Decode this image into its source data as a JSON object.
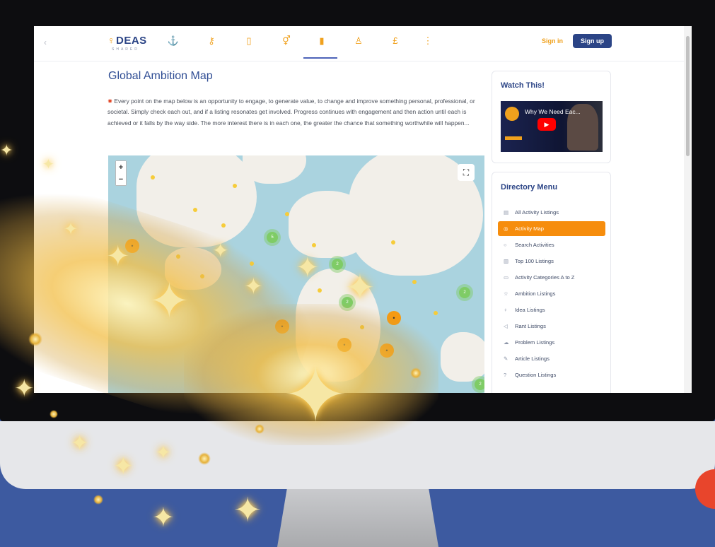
{
  "nav": {
    "logo": "DEAS",
    "logo_sub": "SHARED",
    "icons": [
      "anchor-icon",
      "key-icon",
      "book-icon",
      "gender-icon",
      "database-icon",
      "user-icon",
      "pound-icon",
      "more-icon"
    ],
    "sign_in": "Sign in",
    "sign_up": "Sign up"
  },
  "page": {
    "title": "Global Ambition Map",
    "intro": "Every point on the map below is an opportunity to engage, to generate value, to change and improve something personal, professional, or societal. Simply check each out, and if a listing resonates get involved. Progress continues with engagement and then action until each is achieved or it falls by the way side. The more interest there is in each one, the greater the chance that something worthwhile will happen..."
  },
  "map": {
    "zoom_in": "+",
    "zoom_out": "−",
    "clusters": [
      "5",
      "2",
      "2",
      "2",
      "2"
    ],
    "pins": [
      "•",
      "•",
      "•",
      "•",
      "•"
    ]
  },
  "watch": {
    "title": "Watch This!",
    "video_title": "Why We Need Eac..."
  },
  "directory": {
    "title": "Directory Menu",
    "items": [
      {
        "label": "All Activity Listings",
        "icon": "list-icon"
      },
      {
        "label": "Activity Map",
        "icon": "globe-icon"
      },
      {
        "label": "Search Activities",
        "icon": "search-icon"
      },
      {
        "label": "Top 100 Listings",
        "icon": "chart-icon"
      },
      {
        "label": "Activity Categories A to Z",
        "icon": "calendar-icon"
      },
      {
        "label": "Ambition Listings",
        "icon": "star-icon"
      },
      {
        "label": "Idea Listings",
        "icon": "bulb-icon"
      },
      {
        "label": "Rant Listings",
        "icon": "megaphone-icon"
      },
      {
        "label": "Problem Listings",
        "icon": "cloud-icon"
      },
      {
        "label": "Article Listings",
        "icon": "edit-icon"
      },
      {
        "label": "Question Listings",
        "icon": "question-icon"
      }
    ],
    "active_index": 1
  }
}
